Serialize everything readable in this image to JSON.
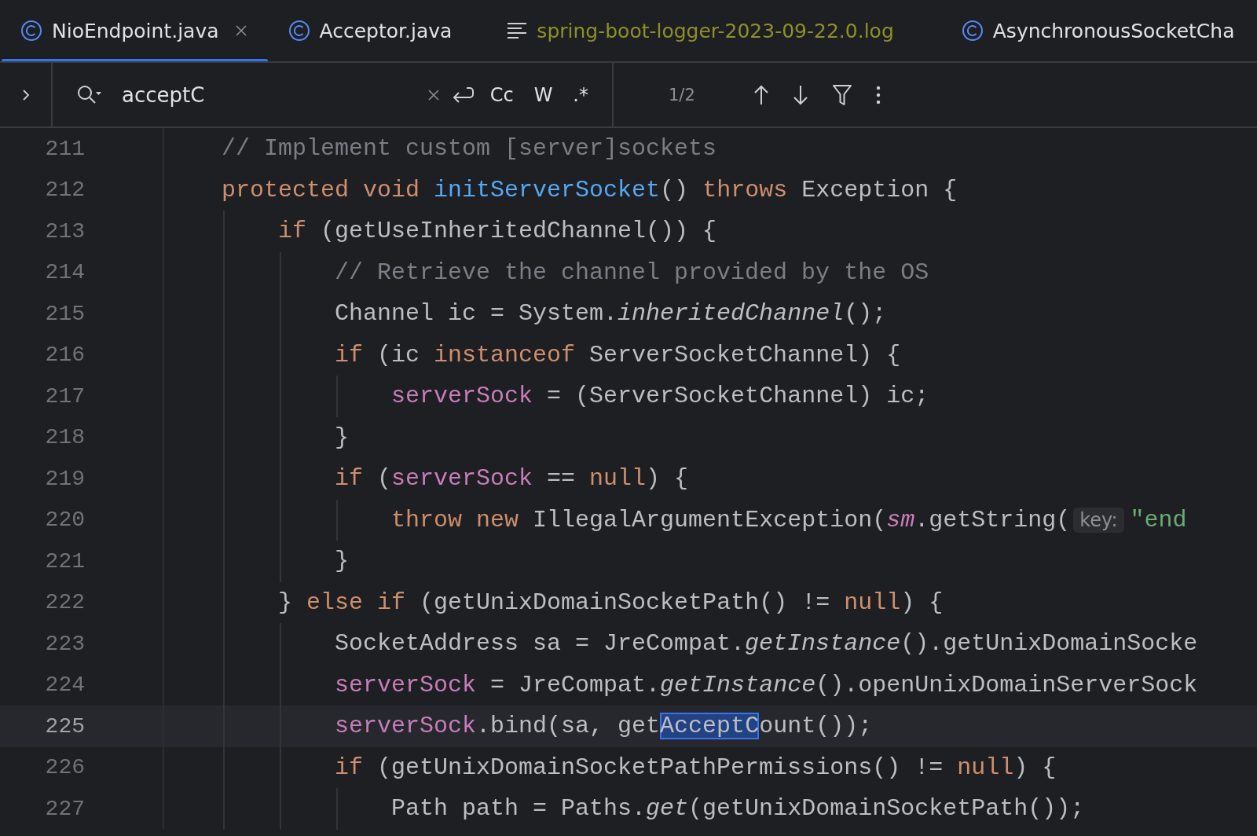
{
  "tabs": [
    {
      "label": "NioEndpoint.java",
      "kind": "class",
      "selected": true,
      "closable": true
    },
    {
      "label": "Acceptor.java",
      "kind": "class",
      "selected": false,
      "closable": false
    },
    {
      "label": "spring-boot-logger-2023-09-22.0.log",
      "kind": "log",
      "selected": false,
      "closable": false
    },
    {
      "label": "AsynchronousSocketCha",
      "kind": "class",
      "selected": false,
      "closable": false
    }
  ],
  "search": {
    "value": "acceptC",
    "options": [
      "Cc",
      "W",
      ".*"
    ],
    "count": "1/2"
  },
  "lines": [
    {
      "number": "211",
      "current": false,
      "tokens": [
        {
          "text": "// Implement custom [server]sockets",
          "kind": "comment"
        }
      ]
    },
    {
      "number": "212",
      "current": false,
      "tokens": [
        {
          "text": "protected",
          "kind": "keyword"
        },
        {
          "text": " void",
          "kind": "keyword"
        },
        {
          "text": " initServerSocket",
          "kind": "declaration"
        },
        {
          "text": "() ",
          "kind": "plain"
        },
        {
          "text": "throws",
          "kind": "keyword"
        },
        {
          "text": " Exception {",
          "kind": "plain"
        }
      ]
    },
    {
      "number": "213",
      "current": false,
      "tokens": [
        {
          "text": "    if",
          "kind": "keyword"
        },
        {
          "text": " (getUseInheritedChannel()) {",
          "kind": "plain"
        }
      ]
    },
    {
      "number": "214",
      "current": false,
      "tokens": [
        {
          "text": "        // Retrieve the channel provided by the OS",
          "kind": "comment"
        }
      ]
    },
    {
      "number": "215",
      "current": false,
      "tokens": [
        {
          "text": "        Channel ic = System.",
          "kind": "plain"
        },
        {
          "text": "inheritedChannel",
          "kind": "static-method"
        },
        {
          "text": "();",
          "kind": "plain"
        }
      ]
    },
    {
      "number": "216",
      "current": false,
      "tokens": [
        {
          "text": "        if",
          "kind": "keyword"
        },
        {
          "text": " (ic ",
          "kind": "plain"
        },
        {
          "text": "instanceof",
          "kind": "keyword"
        },
        {
          "text": " ServerSocketChannel) {",
          "kind": "plain"
        }
      ]
    },
    {
      "number": "217",
      "current": false,
      "tokens": [
        {
          "text": "            serverSock",
          "kind": "field"
        },
        {
          "text": " = (ServerSocketChannel) ic;",
          "kind": "plain"
        }
      ]
    },
    {
      "number": "218",
      "current": false,
      "tokens": [
        {
          "text": "        }",
          "kind": "plain"
        }
      ]
    },
    {
      "number": "219",
      "current": false,
      "tokens": [
        {
          "text": "        if",
          "kind": "keyword"
        },
        {
          "text": " (",
          "kind": "plain"
        },
        {
          "text": "serverSock",
          "kind": "field"
        },
        {
          "text": " == ",
          "kind": "plain"
        },
        {
          "text": "null",
          "kind": "keyword"
        },
        {
          "text": ") {",
          "kind": "plain"
        }
      ]
    },
    {
      "number": "220",
      "current": false,
      "tokens": [
        {
          "text": "            throw",
          "kind": "keyword"
        },
        {
          "text": " new",
          "kind": "keyword"
        },
        {
          "text": " IllegalArgumentException(",
          "kind": "plain"
        },
        {
          "text": "sm",
          "kind": "static-field"
        },
        {
          "text": ".getString(",
          "kind": "plain"
        },
        {
          "text": "key:",
          "kind": "hint"
        },
        {
          "text": "\"end",
          "kind": "string"
        }
      ]
    },
    {
      "number": "221",
      "current": false,
      "tokens": [
        {
          "text": "        }",
          "kind": "plain"
        }
      ]
    },
    {
      "number": "222",
      "current": false,
      "tokens": [
        {
          "text": "    } ",
          "kind": "plain"
        },
        {
          "text": "else",
          "kind": "keyword"
        },
        {
          "text": " if",
          "kind": "keyword"
        },
        {
          "text": " (getUnixDomainSocketPath() != ",
          "kind": "plain"
        },
        {
          "text": "null",
          "kind": "keyword"
        },
        {
          "text": ") {",
          "kind": "plain"
        }
      ]
    },
    {
      "number": "223",
      "current": false,
      "tokens": [
        {
          "text": "        SocketAddress sa = JreCompat.",
          "kind": "plain"
        },
        {
          "text": "getInstance",
          "kind": "static-method"
        },
        {
          "text": "().getUnixDomainSocke",
          "kind": "plain"
        }
      ]
    },
    {
      "number": "224",
      "current": false,
      "tokens": [
        {
          "text": "        serverSock",
          "kind": "field"
        },
        {
          "text": " = JreCompat.",
          "kind": "plain"
        },
        {
          "text": "getInstance",
          "kind": "static-method"
        },
        {
          "text": "().openUnixDomainServerSock",
          "kind": "plain"
        }
      ]
    },
    {
      "number": "225",
      "current": true,
      "tokens": [
        {
          "text": "        serverSock",
          "kind": "field"
        },
        {
          "text": ".bind(sa, get",
          "kind": "plain"
        },
        {
          "text": "AcceptC",
          "kind": "match"
        },
        {
          "text": "ount());",
          "kind": "plain"
        }
      ]
    },
    {
      "number": "226",
      "current": false,
      "tokens": [
        {
          "text": "        if",
          "kind": "keyword"
        },
        {
          "text": " (getUnixDomainSocketPathPermissions() != ",
          "kind": "plain"
        },
        {
          "text": "null",
          "kind": "keyword"
        },
        {
          "text": ") {",
          "kind": "plain"
        }
      ]
    },
    {
      "number": "227",
      "current": false,
      "tokens": [
        {
          "text": "            Path path = Paths.",
          "kind": "plain"
        },
        {
          "text": "get",
          "kind": "static-method"
        },
        {
          "text": "(getUnixDomainSocketPath());",
          "kind": "plain"
        }
      ]
    }
  ]
}
